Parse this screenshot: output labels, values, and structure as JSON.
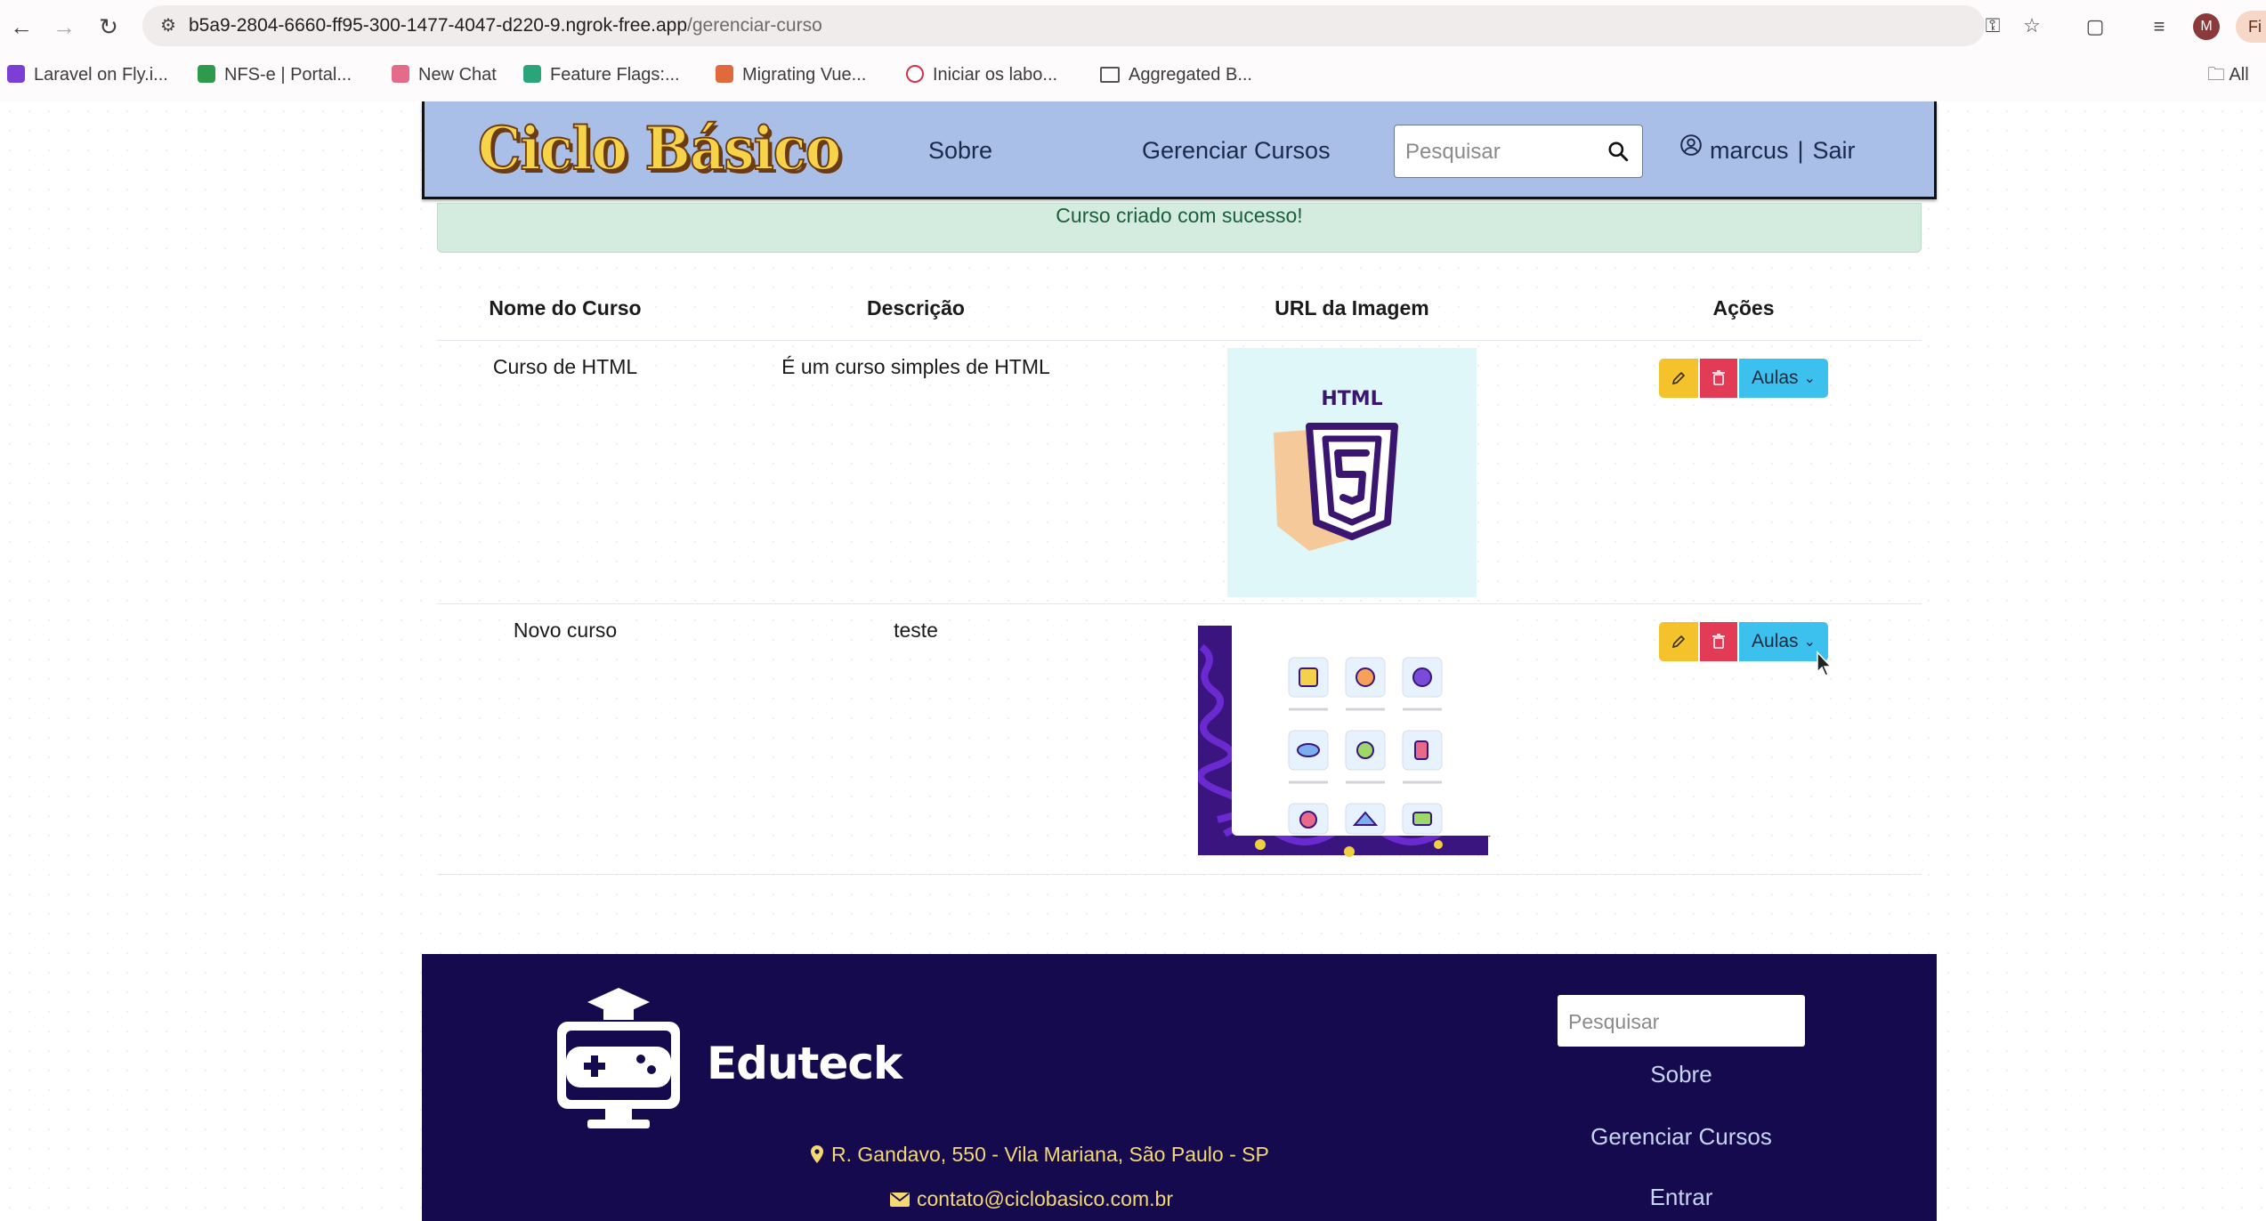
{
  "browser": {
    "url_host": "b5a9-2804-6660-ff95-300-1477-4047-d220-9.ngrok-free.app",
    "url_path": "/gerenciar-curso",
    "profile_initial": "M",
    "side_panel_label": "Fi",
    "bookmarks": [
      {
        "label": "Laravel on Fly.i...",
        "color": "#7b3fd6"
      },
      {
        "label": "NFS-e | Portal...",
        "color": "#2e9a4b"
      },
      {
        "label": "New Chat",
        "color": "#e46b8a"
      },
      {
        "label": "Feature Flags:...",
        "color": "#2aa57a"
      },
      {
        "label": "Migrating Vue...",
        "color": "#e06a3b"
      },
      {
        "label": "Iniciar os labo...",
        "color": "#d6304a"
      },
      {
        "label": "Aggregated B...",
        "color": "#555555"
      }
    ],
    "all_bookmarks": "All"
  },
  "header": {
    "logo_text": "Ciclo Básico",
    "nav": {
      "sobre": "Sobre",
      "gerenciar": "Gerenciar Cursos"
    },
    "search_placeholder": "Pesquisar",
    "user": "marcus",
    "separator": "|",
    "logout": "Sair"
  },
  "alert": {
    "message": "Curso criado com sucesso!"
  },
  "table": {
    "headers": [
      "Nome do Curso",
      "Descrição",
      "URL da Imagem",
      "Ações"
    ],
    "rows": [
      {
        "name": "Curso de HTML",
        "description": "É um curso simples de HTML",
        "image_caption": "HTML",
        "aulas": "Aulas"
      },
      {
        "name": "Novo curso",
        "description": "teste",
        "aulas": "Aulas"
      }
    ]
  },
  "footer": {
    "brand": "Eduteck",
    "address": "R. Gandavo, 550 - Vila Mariana, São Paulo - SP",
    "email": "contato@ciclobasico.com.br",
    "search_placeholder": "Pesquisar",
    "links": [
      "Sobre",
      "Gerenciar Cursos",
      "Entrar"
    ]
  },
  "colors": {
    "header_bg": "#a9bfe8",
    "alert_bg": "#d3ecdf",
    "edit_btn": "#f4c22b",
    "delete_btn": "#e33a55",
    "aulas_btn": "#3cc0ee",
    "footer_bg": "#150a4d",
    "footer_accent": "#f3d873"
  }
}
